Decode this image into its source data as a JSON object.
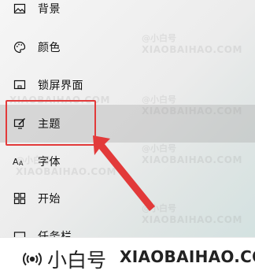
{
  "nav": {
    "items": [
      {
        "label": "背景",
        "icon": "picture-icon"
      },
      {
        "label": "颜色",
        "icon": "palette-icon"
      },
      {
        "label": "锁屏界面",
        "icon": "lock-screen-icon"
      },
      {
        "label": "主题",
        "icon": "theme-icon"
      },
      {
        "label": "字体",
        "icon": "font-icon"
      },
      {
        "label": "开始",
        "icon": "start-icon"
      },
      {
        "label": "任务栏",
        "icon": "taskbar-icon"
      }
    ],
    "selected": "主题"
  },
  "annotation": {
    "highlight_color": "#e23a3a"
  },
  "watermark": {
    "top": "@小白号",
    "big": "XIAOBAIHAO.COM"
  },
  "footer": {
    "brand_cn": "小白号",
    "brand_en": "XIAOBAIHAO.COM"
  }
}
